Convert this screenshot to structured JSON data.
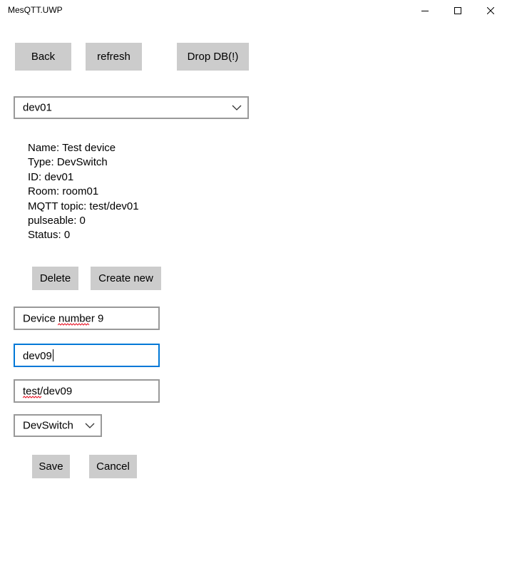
{
  "window": {
    "title": "MesQTT.UWP"
  },
  "toolbar": {
    "back_label": "Back",
    "refresh_label": "refresh",
    "drop_db_label": "Drop DB(!)"
  },
  "device_select": {
    "selected": "dev01"
  },
  "device_info": {
    "lines": [
      "Name: Test device",
      "Type: DevSwitch",
      "ID: dev01",
      "Room: room01",
      "MQTT topic: test/dev01",
      "pulseable: 0",
      "Status: 0"
    ]
  },
  "device_actions": {
    "delete_label": "Delete",
    "create_label": "Create new"
  },
  "form": {
    "name_value": "Device number 9",
    "id_value": "dev09",
    "topic_value": "test/dev09",
    "type_selected": "DevSwitch",
    "save_label": "Save",
    "cancel_label": "Cancel"
  },
  "colors": {
    "button_bg": "#cccccc",
    "border": "#999999",
    "focus_border": "#0078d7",
    "spellcheck": "#e81123"
  }
}
